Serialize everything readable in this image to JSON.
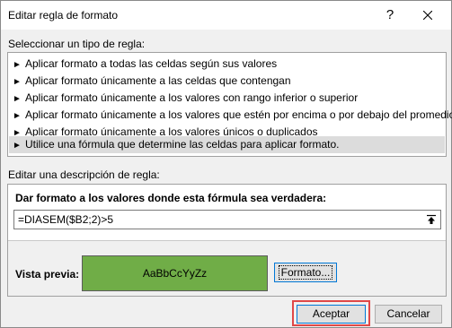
{
  "window": {
    "title": "Editar regla de formato",
    "help_label": "?"
  },
  "rule_type": {
    "label": "Seleccionar un tipo de regla:",
    "items": [
      {
        "label": "Aplicar formato a todas las celdas según sus valores"
      },
      {
        "label": "Aplicar formato únicamente a las celdas que contengan"
      },
      {
        "label": "Aplicar formato únicamente a los valores con rango inferior o superior"
      },
      {
        "label": "Aplicar formato únicamente a los valores que estén por encima o por debajo del promedio"
      },
      {
        "label": "Aplicar formato únicamente a los valores únicos o duplicados"
      },
      {
        "label": "Utilice una fórmula que determine las celdas para aplicar formato."
      }
    ],
    "selected_index": 5,
    "arrow_glyph": "►"
  },
  "description": {
    "label": "Editar una descripción de regla:",
    "heading": "Dar formato a los valores donde esta fórmula sea verdadera:",
    "formula": "=DIASEM($B2;2)>5",
    "preview_label": "Vista previa:",
    "preview_text": "AaBbCcYyZz",
    "preview_fill": "#70ad47",
    "format_button": "Formato..."
  },
  "buttons": {
    "ok": "Aceptar",
    "cancel": "Cancelar"
  },
  "icons": {
    "close": "close-icon",
    "collapse": "collapse-dialog-icon"
  },
  "colors": {
    "selection": "#dcdcdc",
    "focus_border": "#0078d7",
    "highlight": "#e04848"
  }
}
